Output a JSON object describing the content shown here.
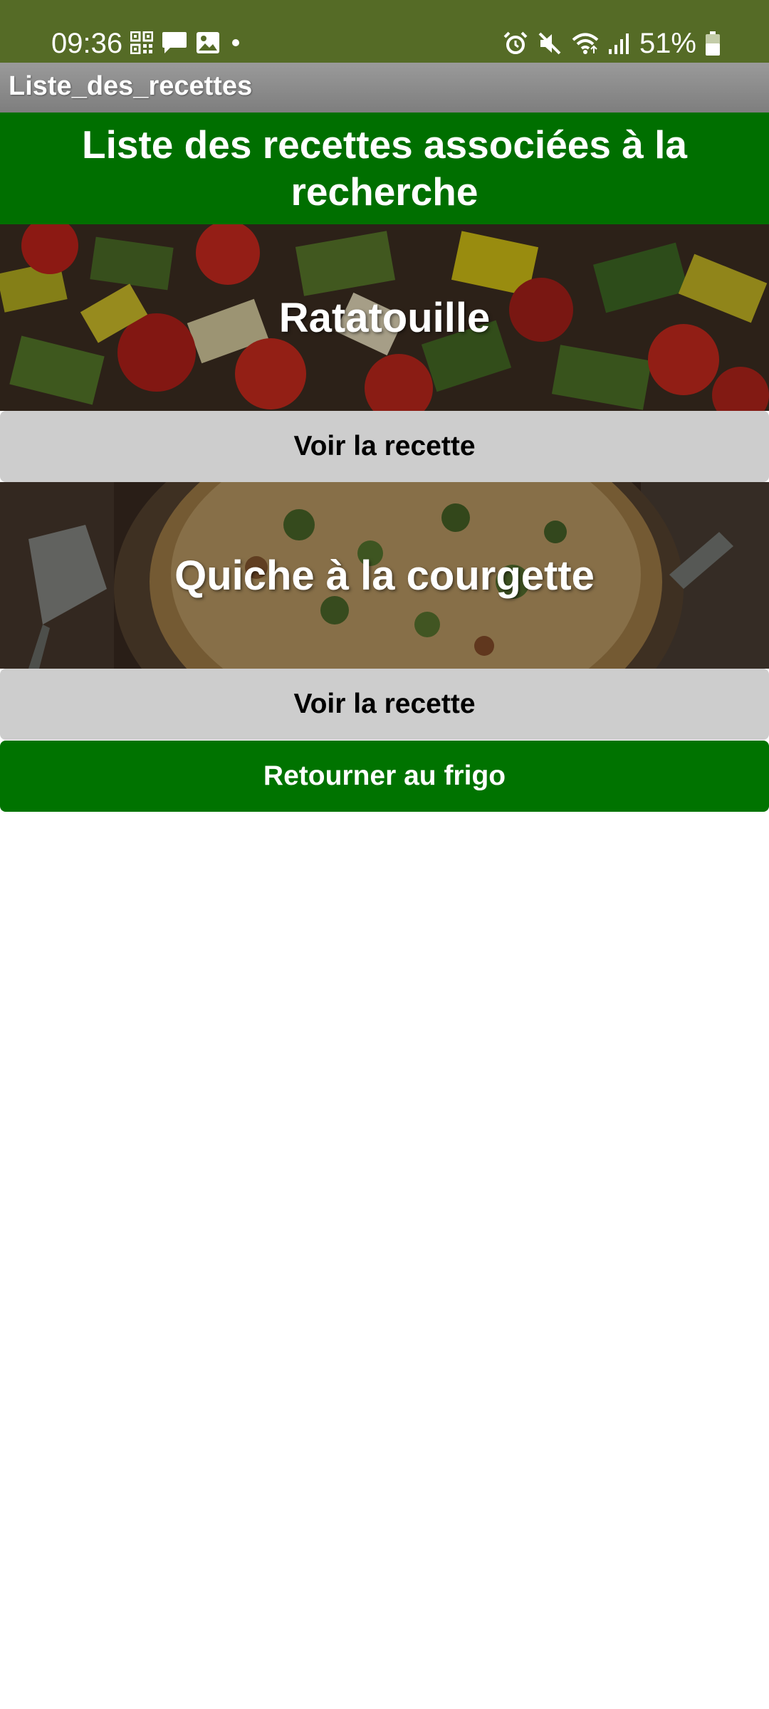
{
  "status_bar": {
    "time": "09:36",
    "battery": "51%",
    "left_icons": [
      "qr-code-icon",
      "message-icon",
      "gallery-icon",
      "dot-icon"
    ],
    "right_icons": [
      "alarm-icon",
      "mute-icon",
      "wifi-icon",
      "signal-icon",
      "battery-icon"
    ]
  },
  "app_bar": {
    "title": "Liste_des_recettes"
  },
  "header": {
    "line1": "Liste des recettes associées à la",
    "line2": "recherche"
  },
  "recipes": [
    {
      "name": "Ratatouille",
      "button_label": "Voir la recette"
    },
    {
      "name": "Quiche à la courgette",
      "button_label": "Voir la recette"
    }
  ],
  "back_button": {
    "label": "Retourner au frigo"
  },
  "colors": {
    "status_bar": "#556b26",
    "header": "#006f00",
    "back_button": "#007300",
    "view_button": "#cdcdcd"
  }
}
